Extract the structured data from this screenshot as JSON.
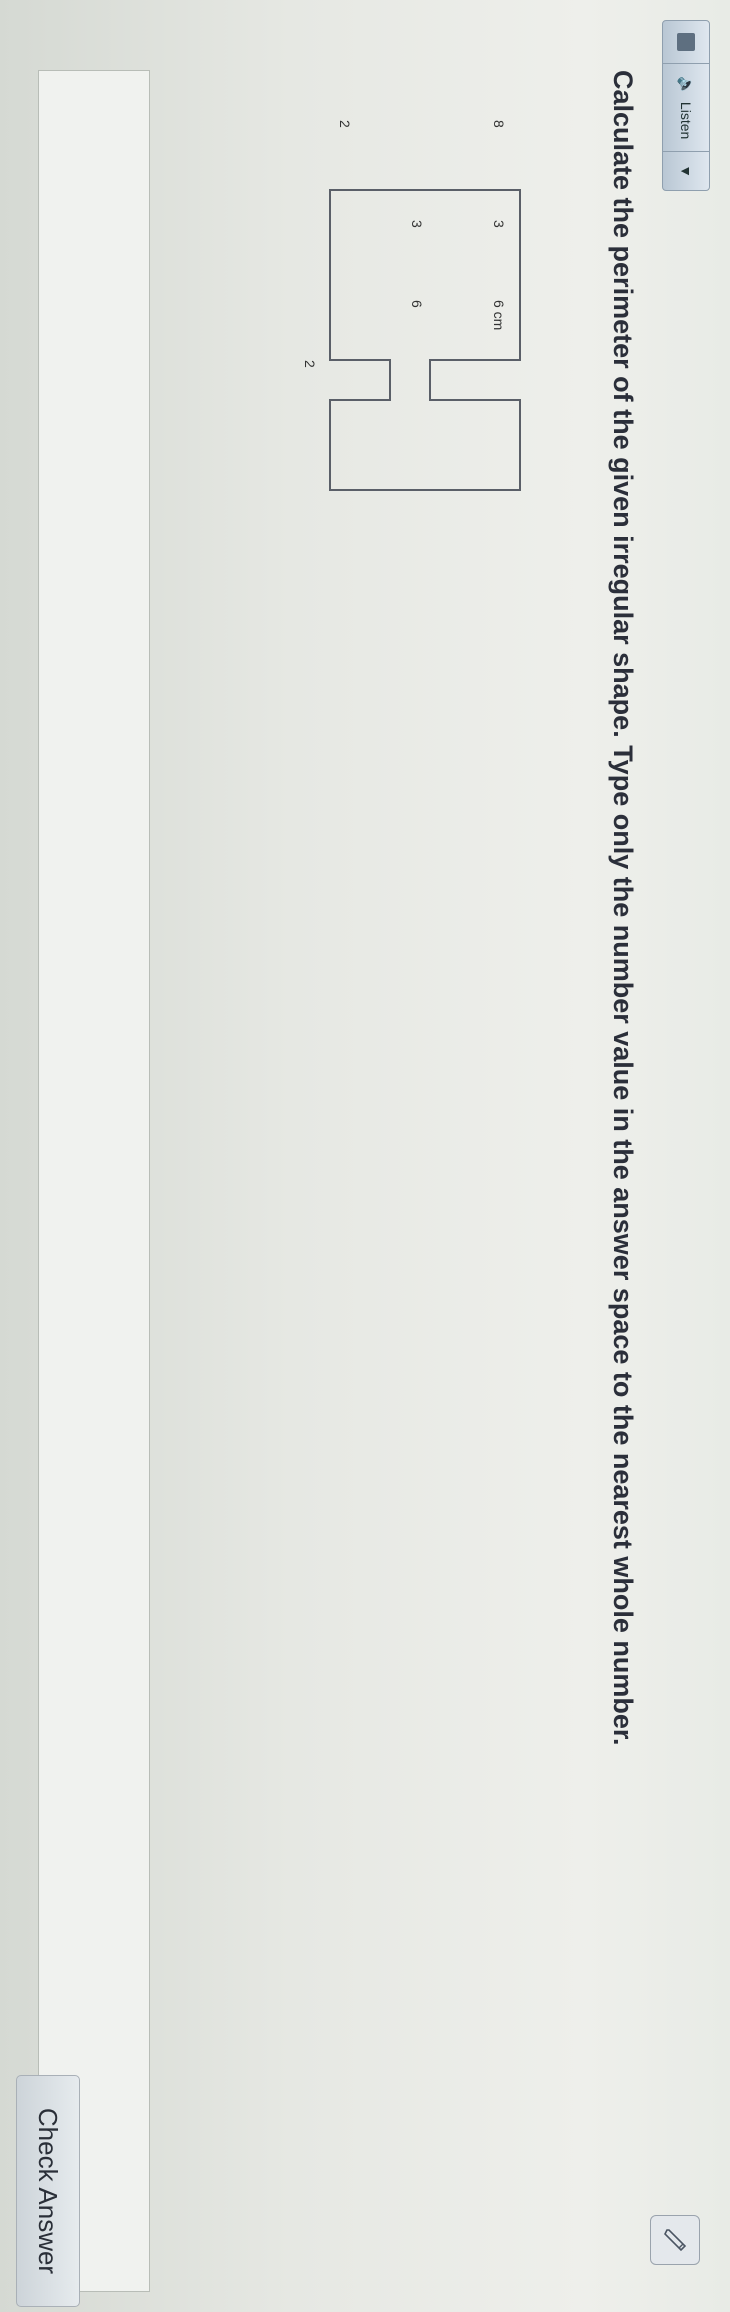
{
  "toolbar": {
    "listen_label": "Listen",
    "icons": [
      "menu-icon",
      "speaker-icon",
      "caret-down-icon"
    ]
  },
  "question": {
    "text": "Calculate the perimeter of the given irregular shape. Type only the number value in the answer space to the nearest whole number."
  },
  "figure": {
    "labels": {
      "top_left_vertical": "8",
      "top_notch_width": "3",
      "top_edge": "6 cm",
      "inner_width": "6",
      "inner_notch": "3",
      "bottom_left": "2",
      "bottom_right": "2"
    },
    "stroke_color": "#5a5f68"
  },
  "answer": {
    "value": ""
  },
  "buttons": {
    "check_answer": "Check Answer"
  },
  "colors": {
    "text": "#2b2f3a",
    "toolbar_bg": "#c9d4de"
  }
}
